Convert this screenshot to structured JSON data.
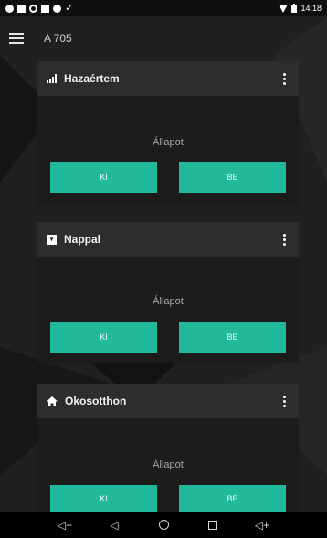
{
  "status_bar": {
    "time": "14:18",
    "icons": [
      "cloud-icon",
      "gallery-icon",
      "eye-icon",
      "save-icon",
      "record-icon",
      "check-icon",
      "wifi-icon",
      "battery-icon"
    ]
  },
  "app_bar": {
    "title": "A 705",
    "menu_icon": "menu-icon"
  },
  "cards": [
    {
      "title": "Hazaértem",
      "icon": "signal-icon",
      "status_label": "Állapot",
      "off_label": "KI",
      "on_label": "BE"
    },
    {
      "title": "Nappal",
      "icon": "square-icon",
      "status_label": "Állapot",
      "off_label": "KI",
      "on_label": "BE"
    },
    {
      "title": "Okosotthon",
      "icon": "home-icon",
      "status_label": "Állapot",
      "off_label": "KI",
      "on_label": "BE"
    }
  ],
  "nav_bar": {
    "items": [
      "volume-down-icon",
      "back-icon",
      "home-icon",
      "recents-icon",
      "volume-up-icon"
    ],
    "volume_down_glyph": "◁−",
    "back_glyph": "◁",
    "volume_up_glyph": "◁+"
  },
  "colors": {
    "accent": "#21b89c",
    "card_header": "#2d2d2d",
    "card_body": "#1c1c1c",
    "background": "#1e1e1e"
  }
}
